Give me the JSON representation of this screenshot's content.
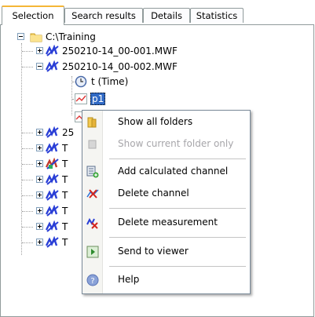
{
  "tabs": [
    {
      "label": "Selection",
      "active": true
    },
    {
      "label": "Search results",
      "active": false
    },
    {
      "label": "Details",
      "active": false
    },
    {
      "label": "Statistics",
      "active": false
    }
  ],
  "tree": {
    "root": "C:\\Training",
    "files": [
      "250210-14_00-001.MWF",
      "250210-14_00-002.MWF",
      "25",
      "T",
      "T",
      "T",
      "T",
      "T",
      "T",
      "T"
    ],
    "channels": [
      "t (Time)",
      "p1"
    ]
  },
  "context_menu": {
    "items": [
      {
        "label": "Show all folders",
        "enabled": true,
        "icon": "folders-icon"
      },
      {
        "label": "Show current folder only",
        "enabled": false,
        "icon": "folder-disabled-icon"
      },
      {
        "label": "Add calculated channel",
        "enabled": true,
        "icon": "calculator-add-icon"
      },
      {
        "label": "Delete channel",
        "enabled": true,
        "icon": "delete-channel-icon"
      },
      {
        "label": "Delete measurement",
        "enabled": true,
        "icon": "delete-measurement-icon"
      },
      {
        "label": "Send to viewer",
        "enabled": true,
        "icon": "send-to-viewer-icon"
      },
      {
        "label": "Help",
        "enabled": true,
        "icon": "help-icon"
      }
    ]
  },
  "colors": {
    "selection": "#316ac5",
    "tab_highlight": "#f5b637",
    "measurement_icon": "#2a3fd6"
  }
}
